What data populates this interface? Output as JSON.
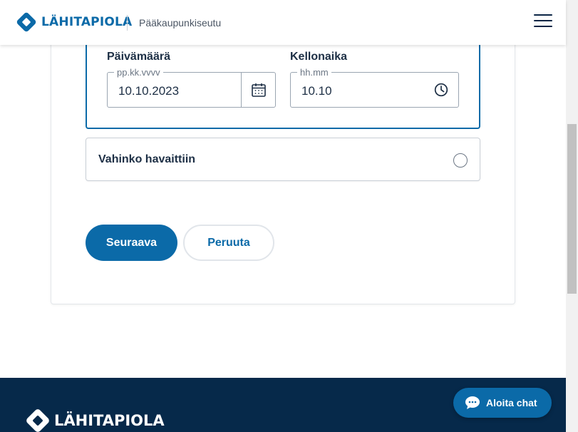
{
  "header": {
    "brand": "LÄHITAPIOLA",
    "region": "Pääkaupunkiseutu",
    "menu_icon": "hamburger-menu-icon"
  },
  "form": {
    "date": {
      "label": "Päivämäärä",
      "placeholder": "pp.kk.vvvv",
      "value": "10.10.2023",
      "icon": "calendar-icon"
    },
    "time": {
      "label": "Kellonaika",
      "placeholder": "hh.mm",
      "value": "10.10",
      "icon": "clock-icon"
    },
    "option": {
      "label": "Vahinko havaittiin",
      "checked": false
    },
    "next_label": "Seuraava",
    "cancel_label": "Peruuta"
  },
  "footer": {
    "brand": "LÄHITAPIOLA"
  },
  "chat": {
    "label": "Aloita chat",
    "icon": "chat-bubble-icon"
  },
  "colors": {
    "primary": "#0b6aa8",
    "footer_bg": "#06294a",
    "text": "#1d2f45"
  }
}
